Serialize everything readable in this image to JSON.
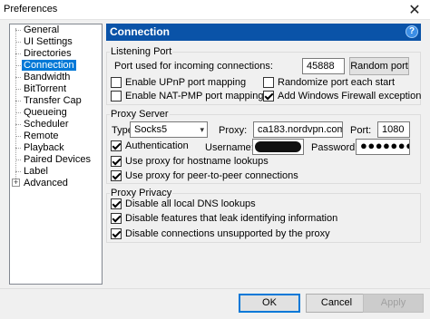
{
  "window": {
    "title": "Preferences"
  },
  "sidebar": {
    "items": [
      {
        "label": "General"
      },
      {
        "label": "UI Settings"
      },
      {
        "label": "Directories"
      },
      {
        "label": "Connection",
        "selected": true
      },
      {
        "label": "Bandwidth"
      },
      {
        "label": "BitTorrent"
      },
      {
        "label": "Transfer Cap"
      },
      {
        "label": "Queueing"
      },
      {
        "label": "Scheduler"
      },
      {
        "label": "Remote"
      },
      {
        "label": "Playback"
      },
      {
        "label": "Paired Devices"
      },
      {
        "label": "Label"
      },
      {
        "label": "Advanced",
        "expandable": true,
        "expander": "+"
      }
    ]
  },
  "panel": {
    "title": "Connection",
    "help": "?"
  },
  "listening_port": {
    "group_label": "Listening Port",
    "port_label": "Port used for incoming connections:",
    "port_value": "45888",
    "random_port_button": "Random port",
    "enable_upnp": {
      "label": "Enable UPnP port mapping",
      "checked": false
    },
    "randomize_port": {
      "label": "Randomize port each start",
      "checked": false
    },
    "enable_natpmp": {
      "label": "Enable NAT-PMP port mapping",
      "checked": false
    },
    "firewall_exception": {
      "label": "Add Windows Firewall exception",
      "checked": true
    }
  },
  "proxy_server": {
    "group_label": "Proxy Server",
    "type_label": "Type:",
    "type_value": "Socks5",
    "proxy_label": "Proxy:",
    "proxy_value": "ca183.nordvpn.com",
    "port_label": "Port:",
    "port_value": "1080",
    "authentication": {
      "label": "Authentication",
      "checked": true
    },
    "username_label": "Username:",
    "password_label": "Password:",
    "password_value": "●●●●●●●",
    "hostname_lookups": {
      "label": "Use proxy for hostname lookups",
      "checked": true
    },
    "peer_connections": {
      "label": "Use proxy for peer-to-peer connections",
      "checked": true
    }
  },
  "proxy_privacy": {
    "group_label": "Proxy Privacy",
    "disable_dns": {
      "label": "Disable all local DNS lookups",
      "checked": true
    },
    "disable_leak": {
      "label": "Disable features that leak identifying information",
      "checked": true
    },
    "disable_unsupported": {
      "label": "Disable connections unsupported by the proxy",
      "checked": true
    }
  },
  "footer": {
    "ok": "OK",
    "cancel": "Cancel",
    "apply": "Apply"
  }
}
